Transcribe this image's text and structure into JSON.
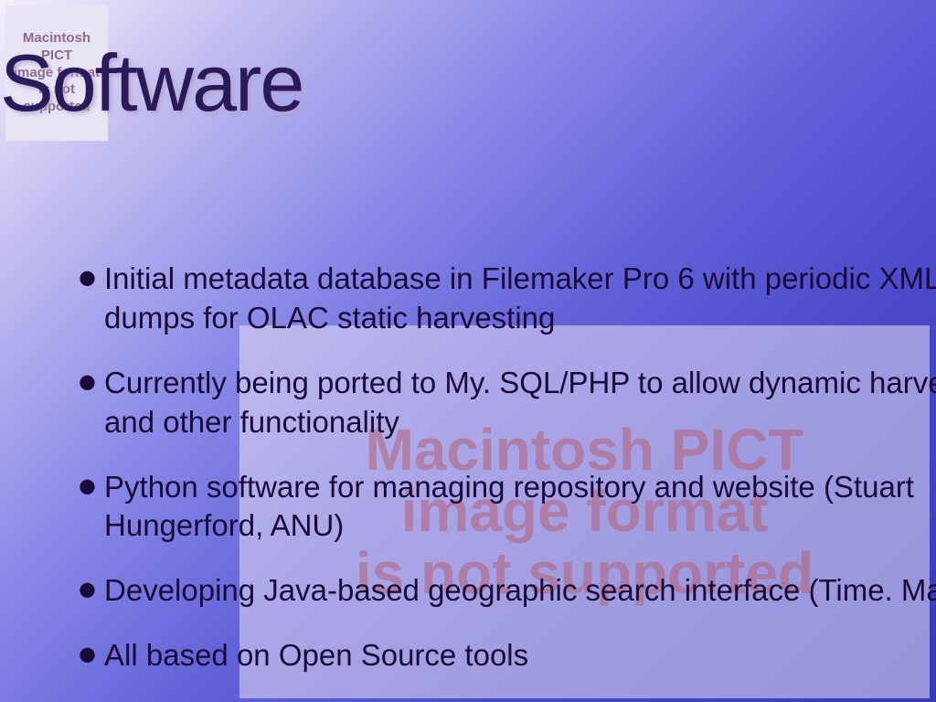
{
  "title": "Software",
  "pict_small": {
    "line1": "Macintosh PICT",
    "line2": "image format",
    "line3": "is not supported"
  },
  "pict_large": {
    "line1": "Macintosh PICT",
    "line2": "image format",
    "line3": "is not supported"
  },
  "bullets": [
    "Initial metadata database in Filemaker Pro 6 with periodic XML dumps for OLAC static harvesting",
    "Currently being  ported to My. SQL/PHP to allow dynamic harvesting and other functionality",
    "Python software for managing repository and website (Stuart Hungerford, ANU)",
    "Developing Java-based geographic search interface (Time. Map)",
    "All based on Open Source tools"
  ]
}
